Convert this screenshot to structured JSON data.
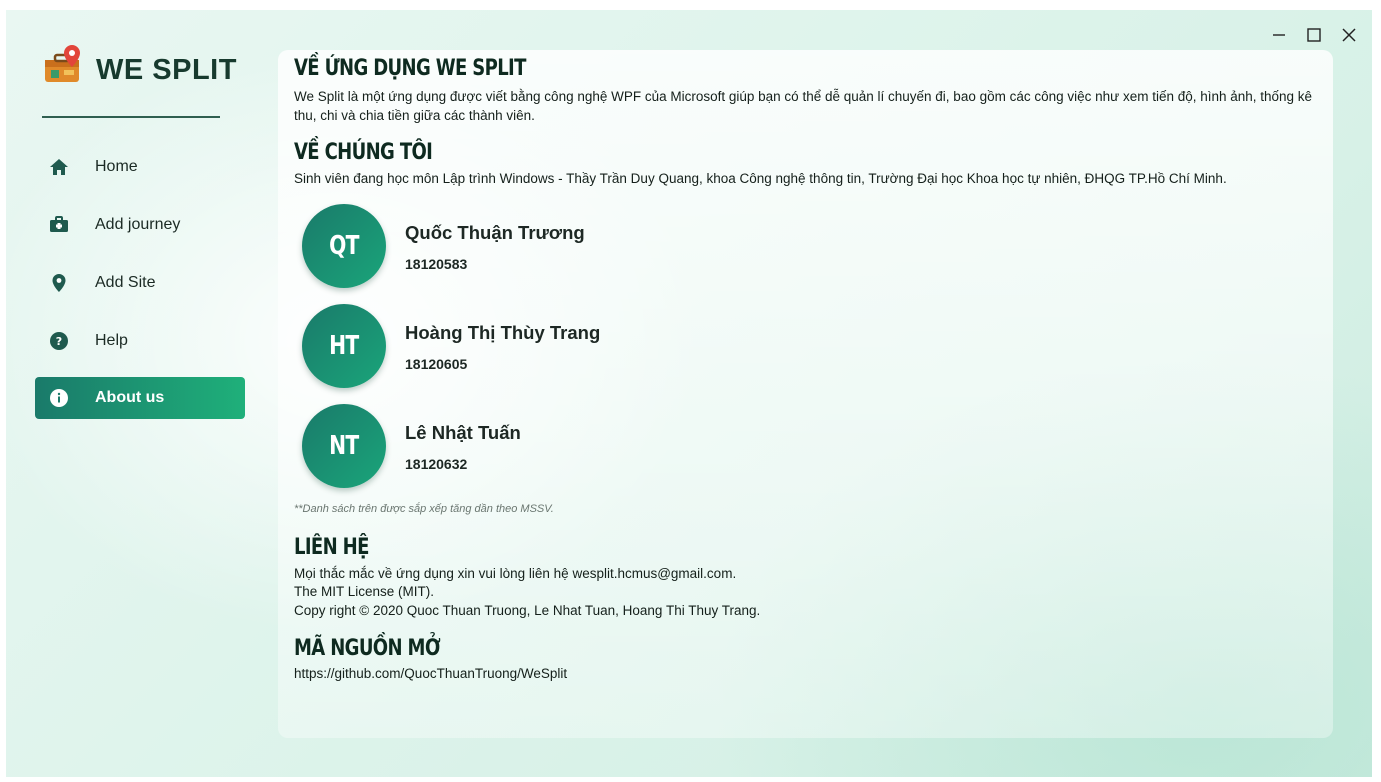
{
  "app": {
    "name": "WE SPLIT"
  },
  "window_controls": {
    "minimize": "minimize-icon",
    "maximize": "maximize-icon",
    "close": "close-icon"
  },
  "sidebar": {
    "items": [
      {
        "label": "Home",
        "icon": "home-icon",
        "active": false
      },
      {
        "label": "Add journey",
        "icon": "briefcase-icon",
        "active": false
      },
      {
        "label": "Add Site",
        "icon": "location-pin-icon",
        "active": false
      },
      {
        "label": "Help",
        "icon": "help-icon",
        "active": false
      },
      {
        "label": "About us",
        "icon": "info-icon",
        "active": true
      }
    ]
  },
  "about_app": {
    "title": "VỀ ỨNG DỤNG WE SPLIT",
    "text": "We Split là một ứng dụng được viết bằng công nghệ WPF của Microsoft giúp bạn có thể dễ quản lí chuyến đi, bao gồm các công việc như xem tiến độ, hình ảnh, thống kê thu, chi và chia tiền giữa các thành viên."
  },
  "about_us": {
    "title": "VỀ CHÚNG TÔI",
    "text": "Sinh viên đang học môn Lập trình Windows - Thầy Trần Duy Quang, khoa Công nghệ thông tin, Trường Đại học Khoa học tự nhiên, ĐHQG TP.Hồ Chí Minh.",
    "members": [
      {
        "initials": "QT",
        "name": "Quốc Thuận Trương",
        "id": "18120583"
      },
      {
        "initials": "HT",
        "name": "Hoàng Thị Thùy Trang",
        "id": "18120605"
      },
      {
        "initials": "NT",
        "name": "Lê Nhật Tuấn",
        "id": "18120632"
      }
    ],
    "note": "**Danh sách trên được sắp xếp tăng dần theo MSSV."
  },
  "contact": {
    "title": "LIÊN HỆ",
    "lines": [
      "Mọi thắc mắc về ứng dụng xin vui lòng liên hệ wesplit.hcmus@gmail.com.",
      "The MIT License (MIT).",
      "Copy right © 2020 Quoc Thuan Truong, Le Nhat Tuan, Hoang Thi Thuy Trang."
    ]
  },
  "open_source": {
    "title": "MÃ NGUỒN MỞ",
    "url": "https://github.com/QuocThuanTruong/WeSplit"
  },
  "colors": {
    "accent_start": "#1a7a6a",
    "accent_end": "#1fb07a",
    "heading": "#0e2a20"
  }
}
